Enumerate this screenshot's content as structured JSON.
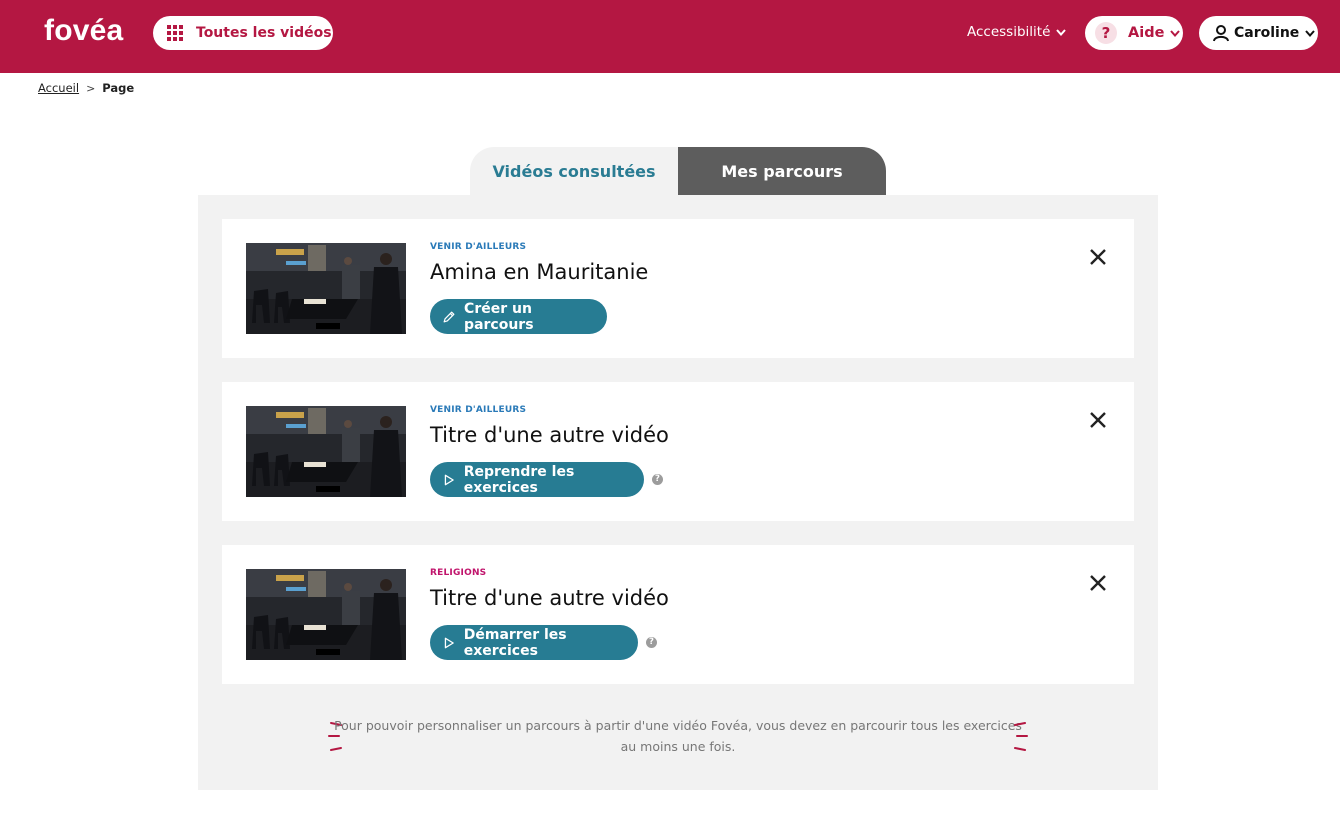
{
  "header": {
    "logo": "fovéa",
    "all_videos_label": "Toutes les vidéos",
    "accessibility_label": "Accessibilité",
    "help_label": "Aide",
    "user_name": "Caroline",
    "brand_color": "#b41742"
  },
  "breadcrumb": {
    "home": "Accueil",
    "separator": ">",
    "current": "Page"
  },
  "tabs": [
    {
      "label": "Vidéos consultées",
      "active": true
    },
    {
      "label": "Mes parcours",
      "active": false
    }
  ],
  "videos": [
    {
      "category": "VENIR D'AILLEURS",
      "category_color": "#2a7ab8",
      "title": "Amina en Mauritanie",
      "action": "Créer un parcours",
      "action_icon": "pencil-icon",
      "help": false
    },
    {
      "category": "VENIR D'AILLEURS",
      "category_color": "#2a7ab8",
      "title": "Titre d'une autre vidéo",
      "action": "Reprendre les exercices",
      "action_icon": "play-icon",
      "help": true
    },
    {
      "category": "RELIGIONS",
      "category_color": "#c0136b",
      "title": "Titre d'une autre vidéo",
      "action": "Démarrer les exercices",
      "action_icon": "play-icon",
      "help": true
    }
  ],
  "help_mark": "?",
  "note": "Pour pouvoir personnaliser un parcours à partir d'une vidéo Fovéa, vous devez en parcourir tous les exercices au moins une fois.",
  "colors": {
    "button": "#277c93",
    "tab_active_text": "#2a7c93",
    "tab_inactive_bg": "#5d5d5d",
    "panel_bg": "#f2f2f2"
  }
}
